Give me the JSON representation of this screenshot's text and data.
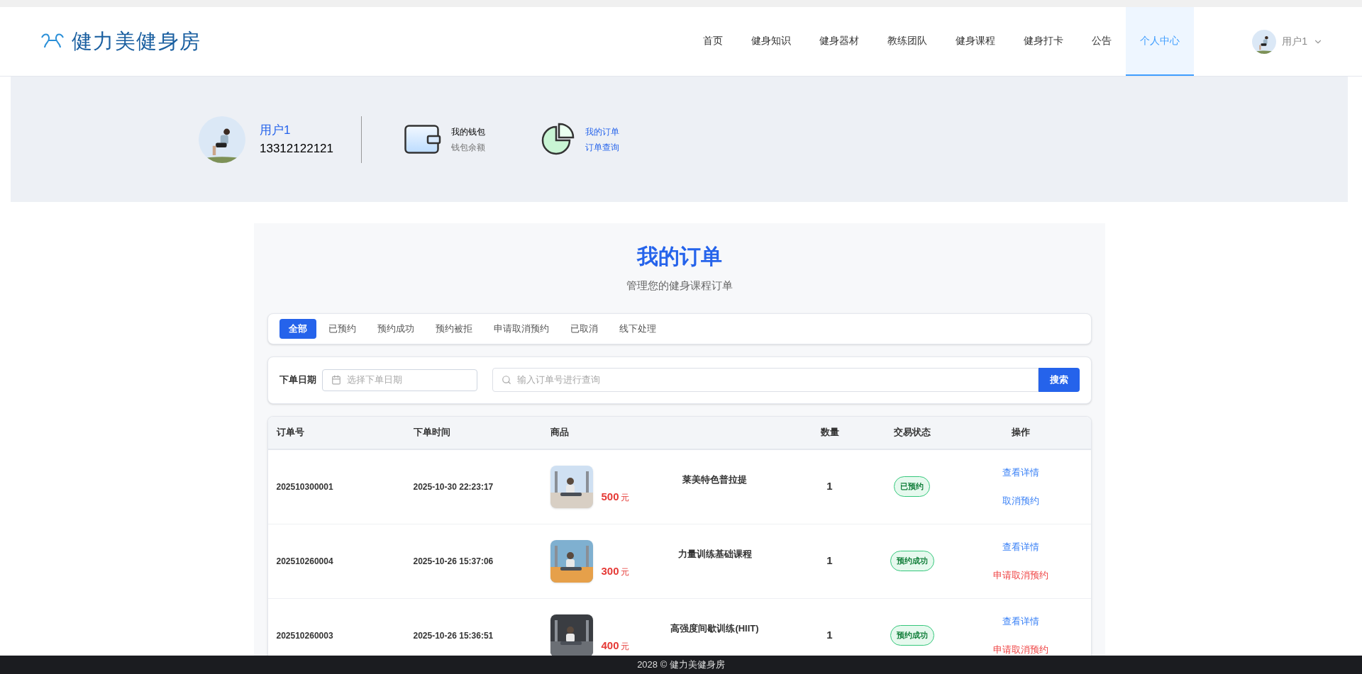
{
  "header": {
    "logo": "健力美健身房",
    "nav": [
      {
        "label": "首页",
        "selected": false
      },
      {
        "label": "健身知识",
        "selected": false
      },
      {
        "label": "健身器材",
        "selected": false
      },
      {
        "label": "教练团队",
        "selected": false
      },
      {
        "label": "健身课程",
        "selected": false
      },
      {
        "label": "健身打卡",
        "selected": false
      },
      {
        "label": "公告",
        "selected": false
      },
      {
        "label": "个人中心",
        "selected": true
      }
    ],
    "user": "用户1"
  },
  "profile": {
    "name": "用户1",
    "phone": "13312122121",
    "wallet": {
      "title": "我的钱包",
      "subtitle": "钱包余额"
    },
    "orders": {
      "title": "我的订单",
      "subtitle": "订单查询"
    }
  },
  "page": {
    "title": "我的订单",
    "subtitle": "管理您的健身课程订单"
  },
  "tabs": [
    {
      "label": "全部",
      "selected": true
    },
    {
      "label": "已预约",
      "selected": false
    },
    {
      "label": "预约成功",
      "selected": false
    },
    {
      "label": "预约被拒",
      "selected": false
    },
    {
      "label": "申请取消预约",
      "selected": false
    },
    {
      "label": "已取消",
      "selected": false
    },
    {
      "label": "线下处理",
      "selected": false
    }
  ],
  "filters": {
    "date_label": "下单日期",
    "date_placeholder": "选择下单日期",
    "search_placeholder": "输入订单号进行查询",
    "search_button": "搜索"
  },
  "table": {
    "columns": [
      "订单号",
      "下单时间",
      "商品",
      "数量",
      "交易状态",
      "操作"
    ],
    "rows": [
      {
        "order_no": "202510300001",
        "time": "2025-10-30 22:23:17",
        "price": "500",
        "unit": "元",
        "product": "莱美特色普拉提",
        "quantity": "1",
        "status": "已预约",
        "actions": [
          {
            "label": "查看详情",
            "kind": "normal"
          },
          {
            "label": "取消预约",
            "kind": "normal"
          }
        ]
      },
      {
        "order_no": "202510260004",
        "time": "2025-10-26 15:37:06",
        "price": "300",
        "unit": "元",
        "product": "力量训练基础课程",
        "quantity": "1",
        "status": "预约成功",
        "actions": [
          {
            "label": "查看详情",
            "kind": "normal"
          },
          {
            "label": "申请取消预约",
            "kind": "danger"
          }
        ]
      },
      {
        "order_no": "202510260003",
        "time": "2025-10-26 15:36:51",
        "price": "400",
        "unit": "元",
        "product": "高强度间歇训练(HIIT)",
        "quantity": "1",
        "status": "预约成功",
        "actions": [
          {
            "label": "查看详情",
            "kind": "normal"
          },
          {
            "label": "申请取消预约",
            "kind": "danger"
          }
        ]
      }
    ]
  },
  "footer": "2028 © 健力美健身房"
}
